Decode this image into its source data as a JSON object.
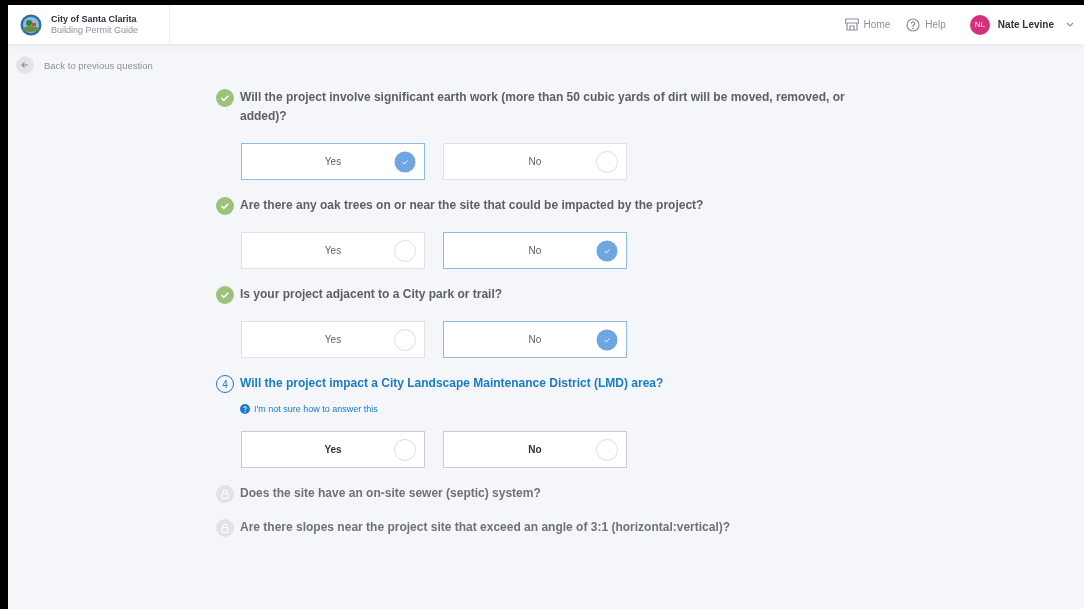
{
  "header": {
    "title": "City of Santa Clarita",
    "subtitle": "Building Permit Guide",
    "nav": [
      {
        "kind": "home",
        "label": "Home"
      },
      {
        "kind": "help",
        "label": "Help"
      }
    ],
    "user": {
      "initials": "NL",
      "name": "Nate Levine"
    }
  },
  "back_link": "Back to previous question",
  "questions": [
    {
      "kind": "done",
      "text": "Will the project involve significant earth work (more than 50 cubic yards of dirt will be moved, removed, or added)?",
      "options": [
        {
          "label": "Yes",
          "selected": true
        },
        {
          "label": "No",
          "selected": false
        }
      ]
    },
    {
      "kind": "done",
      "text": "Are there any oak trees on or near the site that could be impacted by the project?",
      "options": [
        {
          "label": "Yes",
          "selected": false
        },
        {
          "label": "No",
          "selected": true
        }
      ]
    },
    {
      "kind": "done",
      "text": "Is your project adjacent to a City park or trail?",
      "options": [
        {
          "label": "Yes",
          "selected": false
        },
        {
          "label": "No",
          "selected": true
        }
      ]
    },
    {
      "kind": "current",
      "number": "4",
      "text": "Will the project impact a City Landscape Maintenance District (LMD) area?",
      "help": "I'm not sure how to answer this",
      "options": [
        {
          "label": "Yes",
          "selected": false
        },
        {
          "label": "No",
          "selected": false
        }
      ]
    },
    {
      "kind": "locked",
      "text": "Does the site have an on-site sewer (septic) system?"
    },
    {
      "kind": "locked",
      "text": "Are there slopes near the project site that exceed an angle of 3:1 (horizontal:vertical)?"
    }
  ]
}
